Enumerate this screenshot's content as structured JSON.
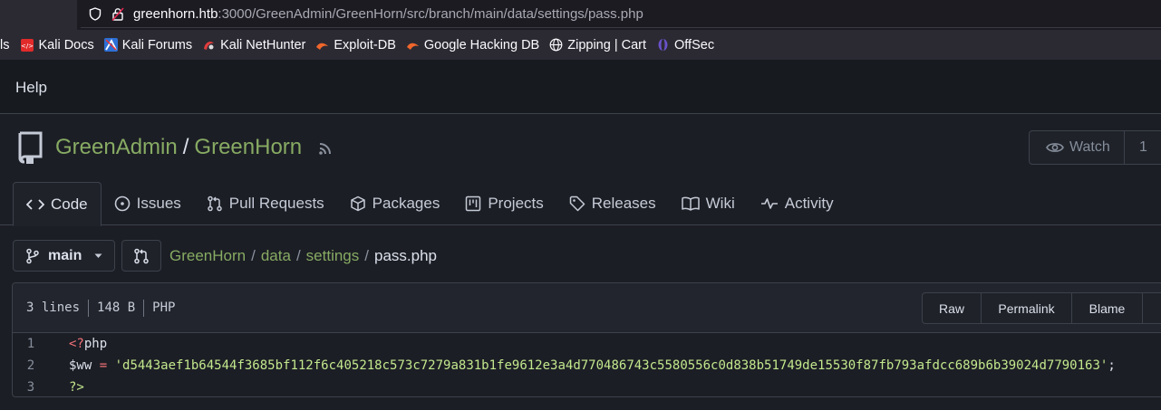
{
  "browser": {
    "url_host": "greenhorn.htb",
    "url_rest": ":3000/GreenAdmin/GreenHorn/src/branch/main/data/settings/pass.php",
    "bookmarks": [
      {
        "label": "ls",
        "icon": "none"
      },
      {
        "label": "Kali Docs",
        "icon": "kali-docs-icon"
      },
      {
        "label": "Kali Forums",
        "icon": "kali-forums-icon"
      },
      {
        "label": "Kali NetHunter",
        "icon": "kali-nethunter-icon"
      },
      {
        "label": "Exploit-DB",
        "icon": "exploit-db-icon"
      },
      {
        "label": "Google Hacking DB",
        "icon": "ghdb-icon"
      },
      {
        "label": "Zipping | Cart",
        "icon": "globe-icon"
      },
      {
        "label": "OffSec",
        "icon": "offsec-icon"
      }
    ]
  },
  "topnav": {
    "help": "Help"
  },
  "repo": {
    "owner": "GreenAdmin",
    "separator": "/",
    "name": "GreenHorn",
    "watch_label": "Watch",
    "watch_count": "1"
  },
  "tabs": [
    {
      "label": "Code",
      "icon": "code-icon",
      "active": true
    },
    {
      "label": "Issues",
      "icon": "issue-icon"
    },
    {
      "label": "Pull Requests",
      "icon": "pull-request-icon"
    },
    {
      "label": "Packages",
      "icon": "package-icon"
    },
    {
      "label": "Projects",
      "icon": "project-icon"
    },
    {
      "label": "Releases",
      "icon": "tag-icon"
    },
    {
      "label": "Wiki",
      "icon": "book-icon"
    },
    {
      "label": "Activity",
      "icon": "pulse-icon"
    }
  ],
  "branch": {
    "name": "main"
  },
  "path": {
    "root": "GreenHorn",
    "dir1": "data",
    "dir2": "settings",
    "file": "pass.php",
    "sep": "/"
  },
  "file": {
    "lines": "3 lines",
    "size": "148 B",
    "lang": "PHP",
    "buttons": {
      "raw": "Raw",
      "permalink": "Permalink",
      "blame": "Blame"
    },
    "code": [
      {
        "num": "1",
        "open": "<?",
        "php": "php"
      },
      {
        "num": "2",
        "var": "$ww",
        "op": " = ",
        "str": "'d5443aef1b64544f3685bf112f6c405218c573c7279a831b1fe9612e3a4d770486743c5580556c0d838b51749de15530f87fb793afdcc689b6b39024d7790163'",
        "end": ";"
      },
      {
        "num": "3",
        "close": "?>"
      }
    ]
  },
  "colors": {
    "accent_green": "#87ab63",
    "bg": "#1c1e25",
    "border": "#3c414b"
  }
}
